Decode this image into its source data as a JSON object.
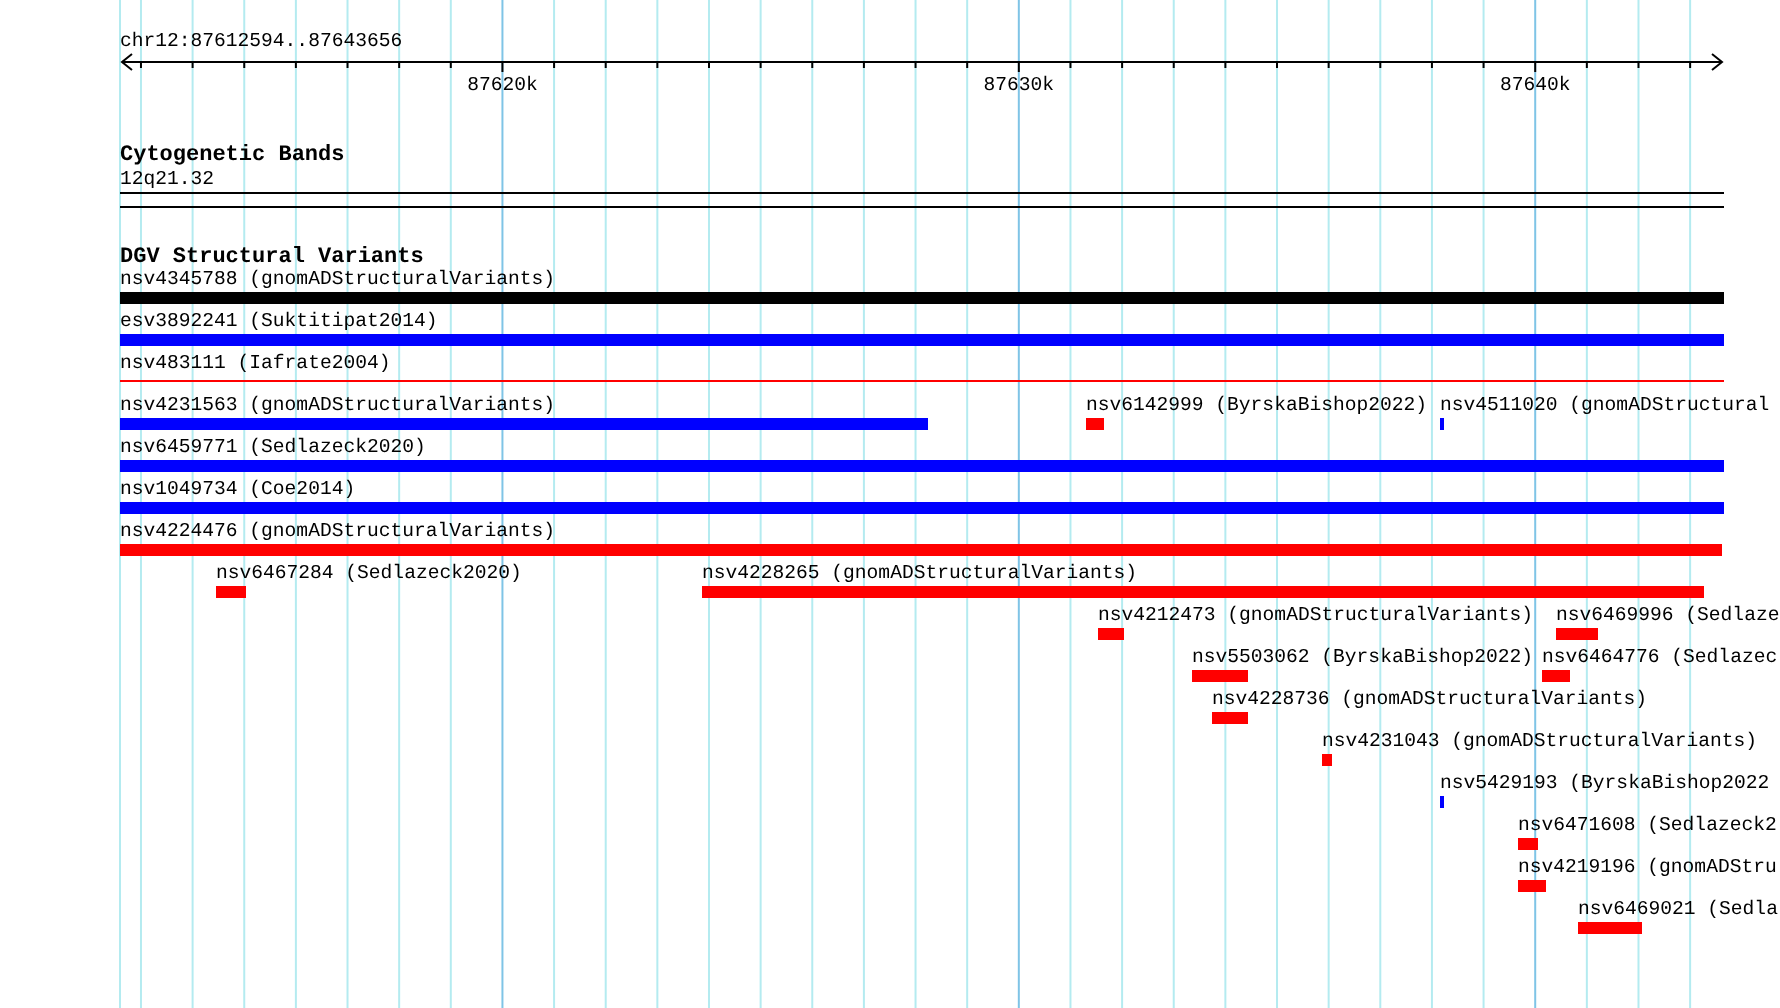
{
  "ruler": {
    "location": "chr12:87612594..87643656",
    "tick_labels": [
      "87620k",
      "87630k",
      "87640k"
    ]
  },
  "cytogenetic_bands": {
    "title": "Cytogenetic Bands",
    "band": "12q21.32"
  },
  "dgv": {
    "title": "DGV Structural Variants",
    "features": [
      {
        "label": "nsv4345788 (gnomADStructuralVariants)",
        "color": "#000000",
        "kind": "bar"
      },
      {
        "label": "esv3892241 (Suktitipat2014)",
        "color": "#0000ff",
        "kind": "bar"
      },
      {
        "label": "nsv483111 (Iafrate2004)",
        "color": "#ff0000",
        "kind": "line"
      },
      {
        "label": "nsv4231563 (gnomADStructuralVariants)",
        "color": "#0000ff",
        "kind": "bar"
      },
      {
        "label": "nsv6142999 (ByrskaBishop2022)",
        "color": "#ff0000",
        "kind": "bar"
      },
      {
        "label": "nsv4511020 (gnomADStructural",
        "color": "#0000ff",
        "kind": "bar"
      },
      {
        "label": "nsv6459771 (Sedlazeck2020)",
        "color": "#0000ff",
        "kind": "bar"
      },
      {
        "label": "nsv1049734 (Coe2014)",
        "color": "#0000ff",
        "kind": "bar"
      },
      {
        "label": "nsv4224476 (gnomADStructuralVariants)",
        "color": "#ff0000",
        "kind": "bar"
      },
      {
        "label": "nsv6467284 (Sedlazeck2020)",
        "color": "#ff0000",
        "kind": "bar"
      },
      {
        "label": "nsv4228265 (gnomADStructuralVariants)",
        "color": "#ff0000",
        "kind": "bar"
      },
      {
        "label": "nsv4212473 (gnomADStructuralVariants)",
        "color": "#ff0000",
        "kind": "bar"
      },
      {
        "label": "nsv6469996 (Sedlaze",
        "color": "#ff0000",
        "kind": "bar"
      },
      {
        "label": "nsv5503062 (ByrskaBishop2022)",
        "color": "#ff0000",
        "kind": "bar"
      },
      {
        "label": "nsv6464776 (Sedlazec",
        "color": "#ff0000",
        "kind": "bar"
      },
      {
        "label": "nsv4228736 (gnomADStructuralVariants)",
        "color": "#ff0000",
        "kind": "bar"
      },
      {
        "label": "nsv4231043 (gnomADStructuralVariants)",
        "color": "#ff0000",
        "kind": "bar"
      },
      {
        "label": "nsv5429193 (ByrskaBishop2022",
        "color": "#0000ff",
        "kind": "bar"
      },
      {
        "label": "nsv6471608 (Sedlazeck2",
        "color": "#ff0000",
        "kind": "bar"
      },
      {
        "label": "nsv4219196 (gnomADStru",
        "color": "#ff0000",
        "kind": "bar"
      },
      {
        "label": "nsv6469021 (Sedla",
        "color": "#ff0000",
        "kind": "bar"
      }
    ]
  }
}
